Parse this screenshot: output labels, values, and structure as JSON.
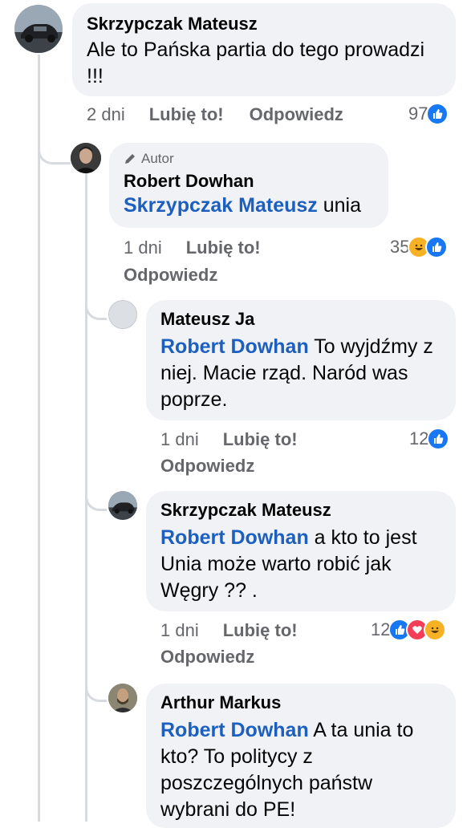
{
  "comments": [
    {
      "author": "Skrzypczak Mateusz",
      "text": "Ale to Pańska partia do tego prowadzi !!!",
      "time": "2 dni",
      "like_label": "Lubię to!",
      "reply_label": "Odpowiedz",
      "reaction_count": "97",
      "reactions": [
        "like-icon"
      ]
    },
    {
      "badge": "Autor",
      "author": "Robert Dowhan",
      "mention": "Skrzypczak Mateusz",
      "text": " unia",
      "time": "1 dni",
      "like_label": "Lubię to!",
      "reply_label": "Odpowiedz",
      "reaction_count": "35",
      "reactions": [
        "haha-icon",
        "like-icon"
      ]
    },
    {
      "author": "Mateusz Ja",
      "mention": "Robert Dowhan",
      "text": " To wyjdźmy z niej. Macie rząd. Naród was poprze.",
      "time": "1 dni",
      "like_label": "Lubię to!",
      "reply_label": "Odpowiedz",
      "reaction_count": "12",
      "reactions": [
        "like-icon"
      ]
    },
    {
      "author": "Skrzypczak Mateusz",
      "mention": "Robert Dowhan",
      "text": " a kto to jest Unia może warto robić jak Węgry ?? .",
      "time": "1 dni",
      "like_label": "Lubię to!",
      "reply_label": "Odpowiedz",
      "reaction_count": "12",
      "reactions": [
        "like-icon",
        "love-icon",
        "haha-icon"
      ]
    },
    {
      "author": "Arthur Markus",
      "mention": "Robert Dowhan",
      "text": " A ta unia to kto? To politycy z poszczególnych państw wybrani do PE!"
    }
  ],
  "colors": {
    "bubble": "#f0f2f5",
    "mention": "#1d5fbf",
    "meta": "#65676b",
    "like": "#1877f2",
    "love": "#f33e58",
    "haha": "#f7b125"
  }
}
